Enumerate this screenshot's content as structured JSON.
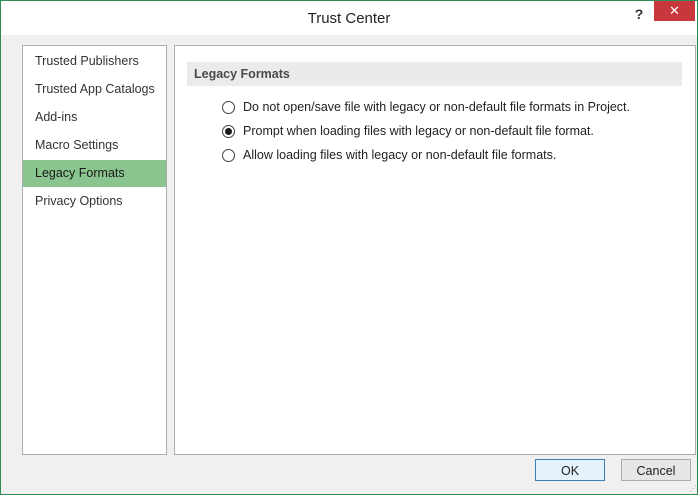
{
  "window": {
    "title": "Trust Center",
    "help_label": "?",
    "close_label": "✕"
  },
  "sidebar": {
    "items": [
      {
        "label": "Trusted Publishers",
        "selected": false
      },
      {
        "label": "Trusted App Catalogs",
        "selected": false
      },
      {
        "label": "Add-ins",
        "selected": false
      },
      {
        "label": "Macro Settings",
        "selected": false
      },
      {
        "label": "Legacy Formats",
        "selected": true
      },
      {
        "label": "Privacy Options",
        "selected": false
      }
    ]
  },
  "main": {
    "section_title": "Legacy Formats",
    "options": [
      {
        "label": "Do not open/save file with legacy or non-default file formats in Project.",
        "checked": false
      },
      {
        "label": "Prompt when loading files with legacy or non-default file format.",
        "checked": true
      },
      {
        "label": "Allow loading files with legacy or non-default file formats.",
        "checked": false
      }
    ]
  },
  "footer": {
    "ok_label": "OK",
    "cancel_label": "Cancel"
  },
  "colors": {
    "selected_item": "#8ac58f",
    "close_button": "#c7373b",
    "window_border": "#2e8b57"
  }
}
